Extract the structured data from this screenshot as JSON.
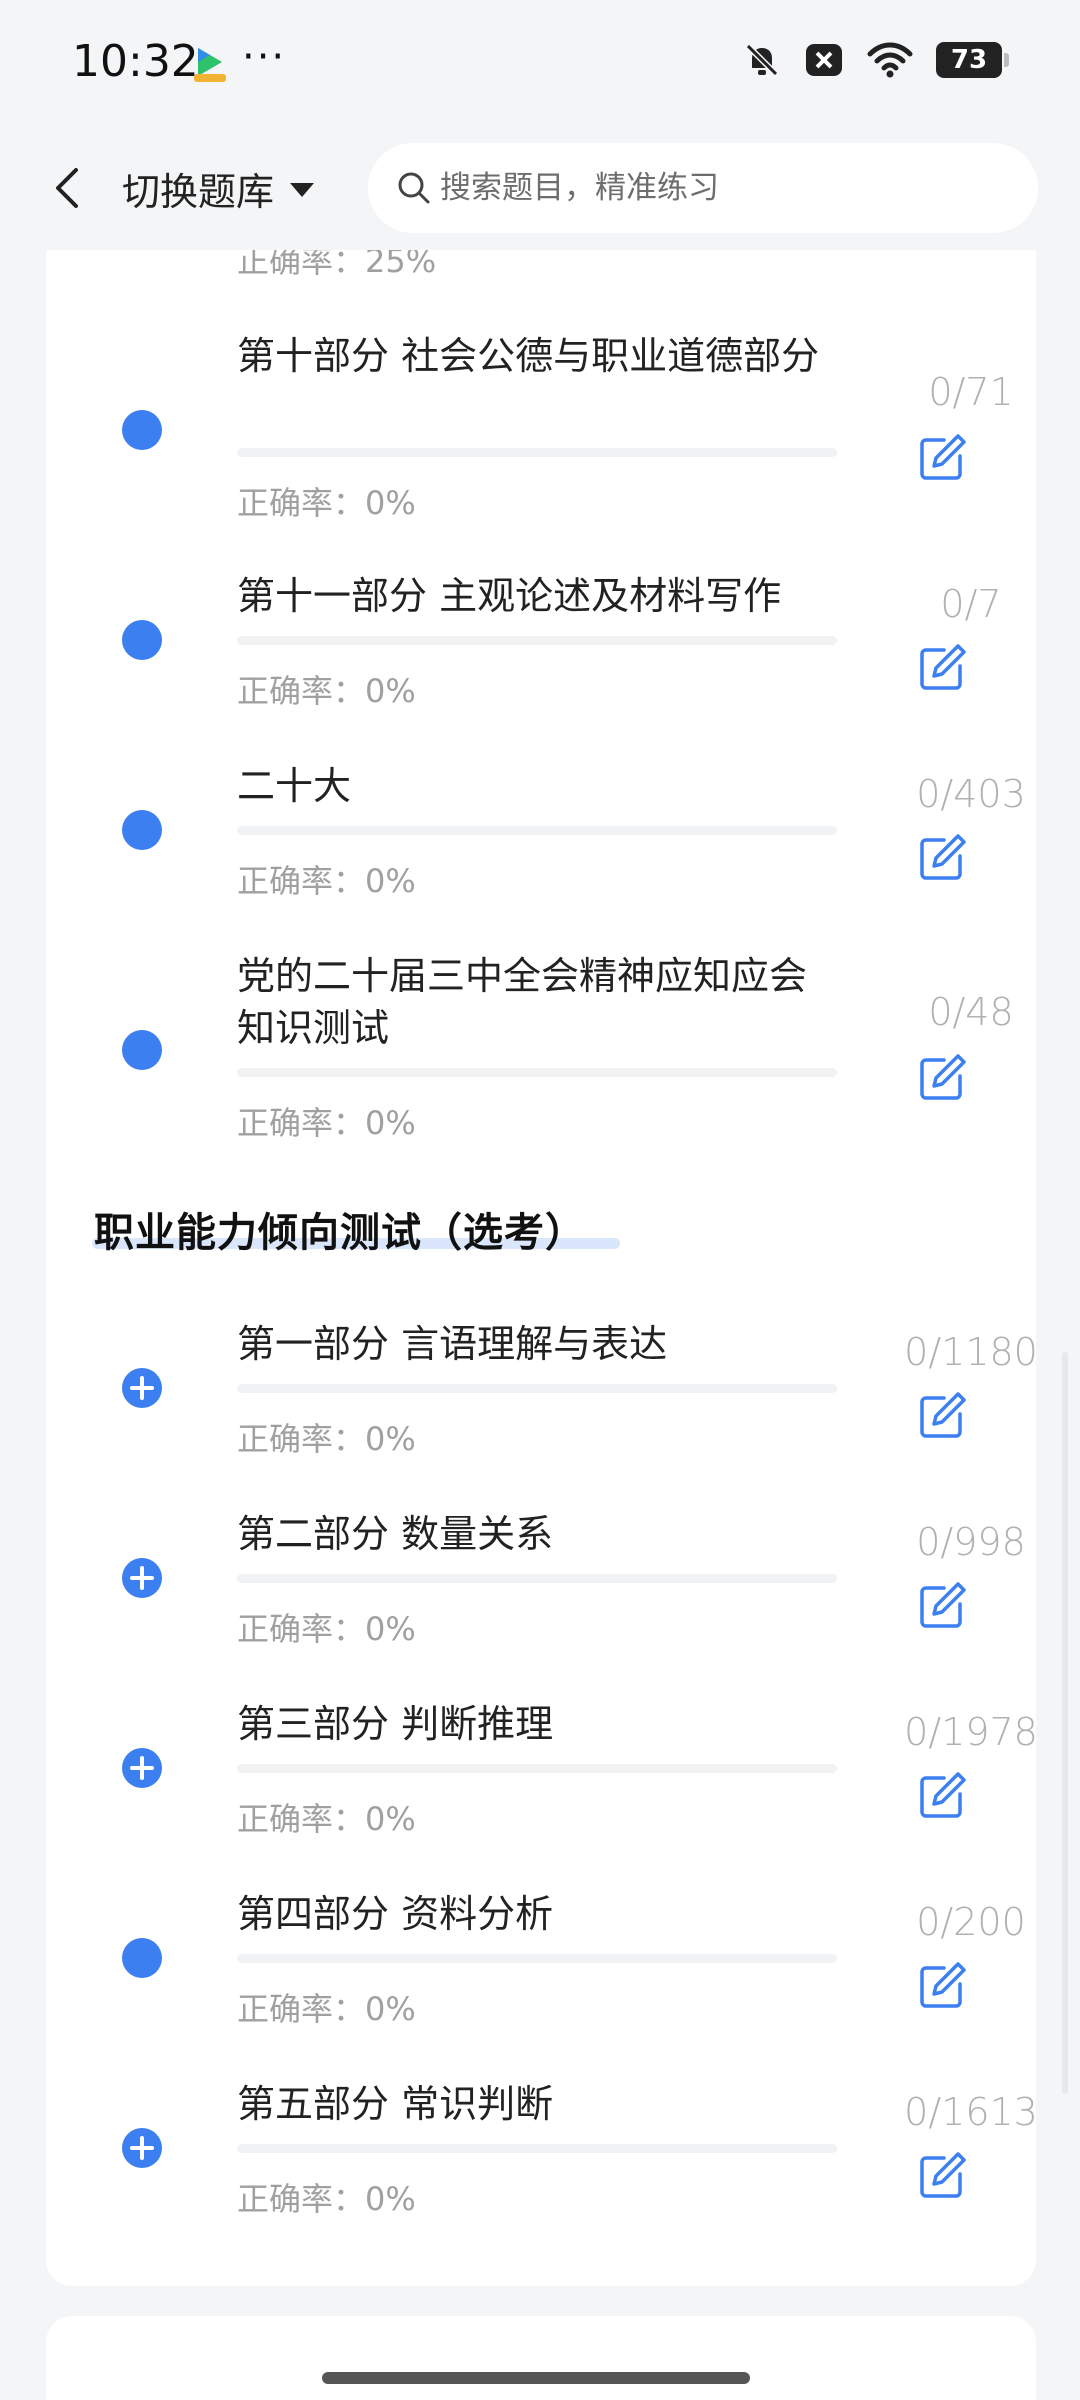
{
  "status_bar": {
    "time": "10:32",
    "dots": "···",
    "battery": "73",
    "icons": [
      "bell-off-icon",
      "close-box-icon",
      "wifi-icon",
      "battery-icon"
    ]
  },
  "header": {
    "bank_label": "切换题库",
    "search_placeholder": "搜索题目，精准练习"
  },
  "cut_rate": "正确率：25%",
  "items": [
    {
      "title": "第十部分 社会公德与职业道德部分",
      "rate": "正确率：0%",
      "count": "0/71",
      "icon": "dot"
    },
    {
      "title": "第十一部分 主观论述及材料写作",
      "rate": "正确率：0%",
      "count": "0/7",
      "icon": "dot"
    },
    {
      "title": "二十大",
      "rate": "正确率：0%",
      "count": "0/403",
      "icon": "dot"
    },
    {
      "title": "党的二十届三中全会精神应知应会知识测试",
      "rate": "正确率：0%",
      "count": "0/48",
      "icon": "dot"
    }
  ],
  "section": {
    "title": "职业能力倾向测试（选考）"
  },
  "section_items": [
    {
      "title": "第一部分 言语理解与表达",
      "rate": "正确率：0%",
      "count": "0/1180",
      "icon": "plus"
    },
    {
      "title": "第二部分 数量关系",
      "rate": "正确率：0%",
      "count": "0/998",
      "icon": "plus"
    },
    {
      "title": "第三部分 判断推理",
      "rate": "正确率：0%",
      "count": "0/1978",
      "icon": "plus"
    },
    {
      "title": "第四部分 资料分析",
      "rate": "正确率：0%",
      "count": "0/200",
      "icon": "dot"
    },
    {
      "title": "第五部分 常识判断",
      "rate": "正确率：0%",
      "count": "0/1613",
      "icon": "plus"
    }
  ],
  "colors": {
    "accent": "#3b7ff0",
    "muted": "#a0a0a0",
    "background": "#f4f5f7"
  }
}
